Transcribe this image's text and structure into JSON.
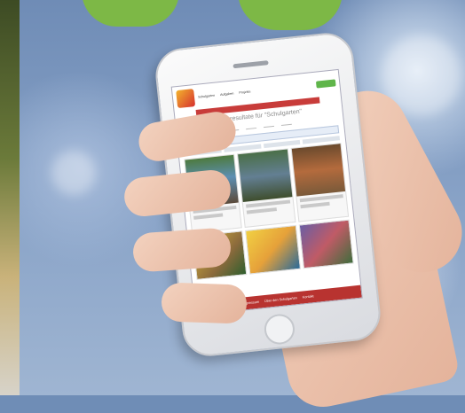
{
  "phone_app": {
    "nav": [
      "Schulgarten",
      "Aufgaben",
      "Projekte"
    ],
    "page_title": "Suchresultate für \"Schulgarten\"",
    "footer_links": [
      "Impressum",
      "Über den Schulgarten",
      "Kontakt"
    ]
  },
  "colors": {
    "accent_red": "#c83c3a",
    "accent_green": "#5fb54a"
  }
}
